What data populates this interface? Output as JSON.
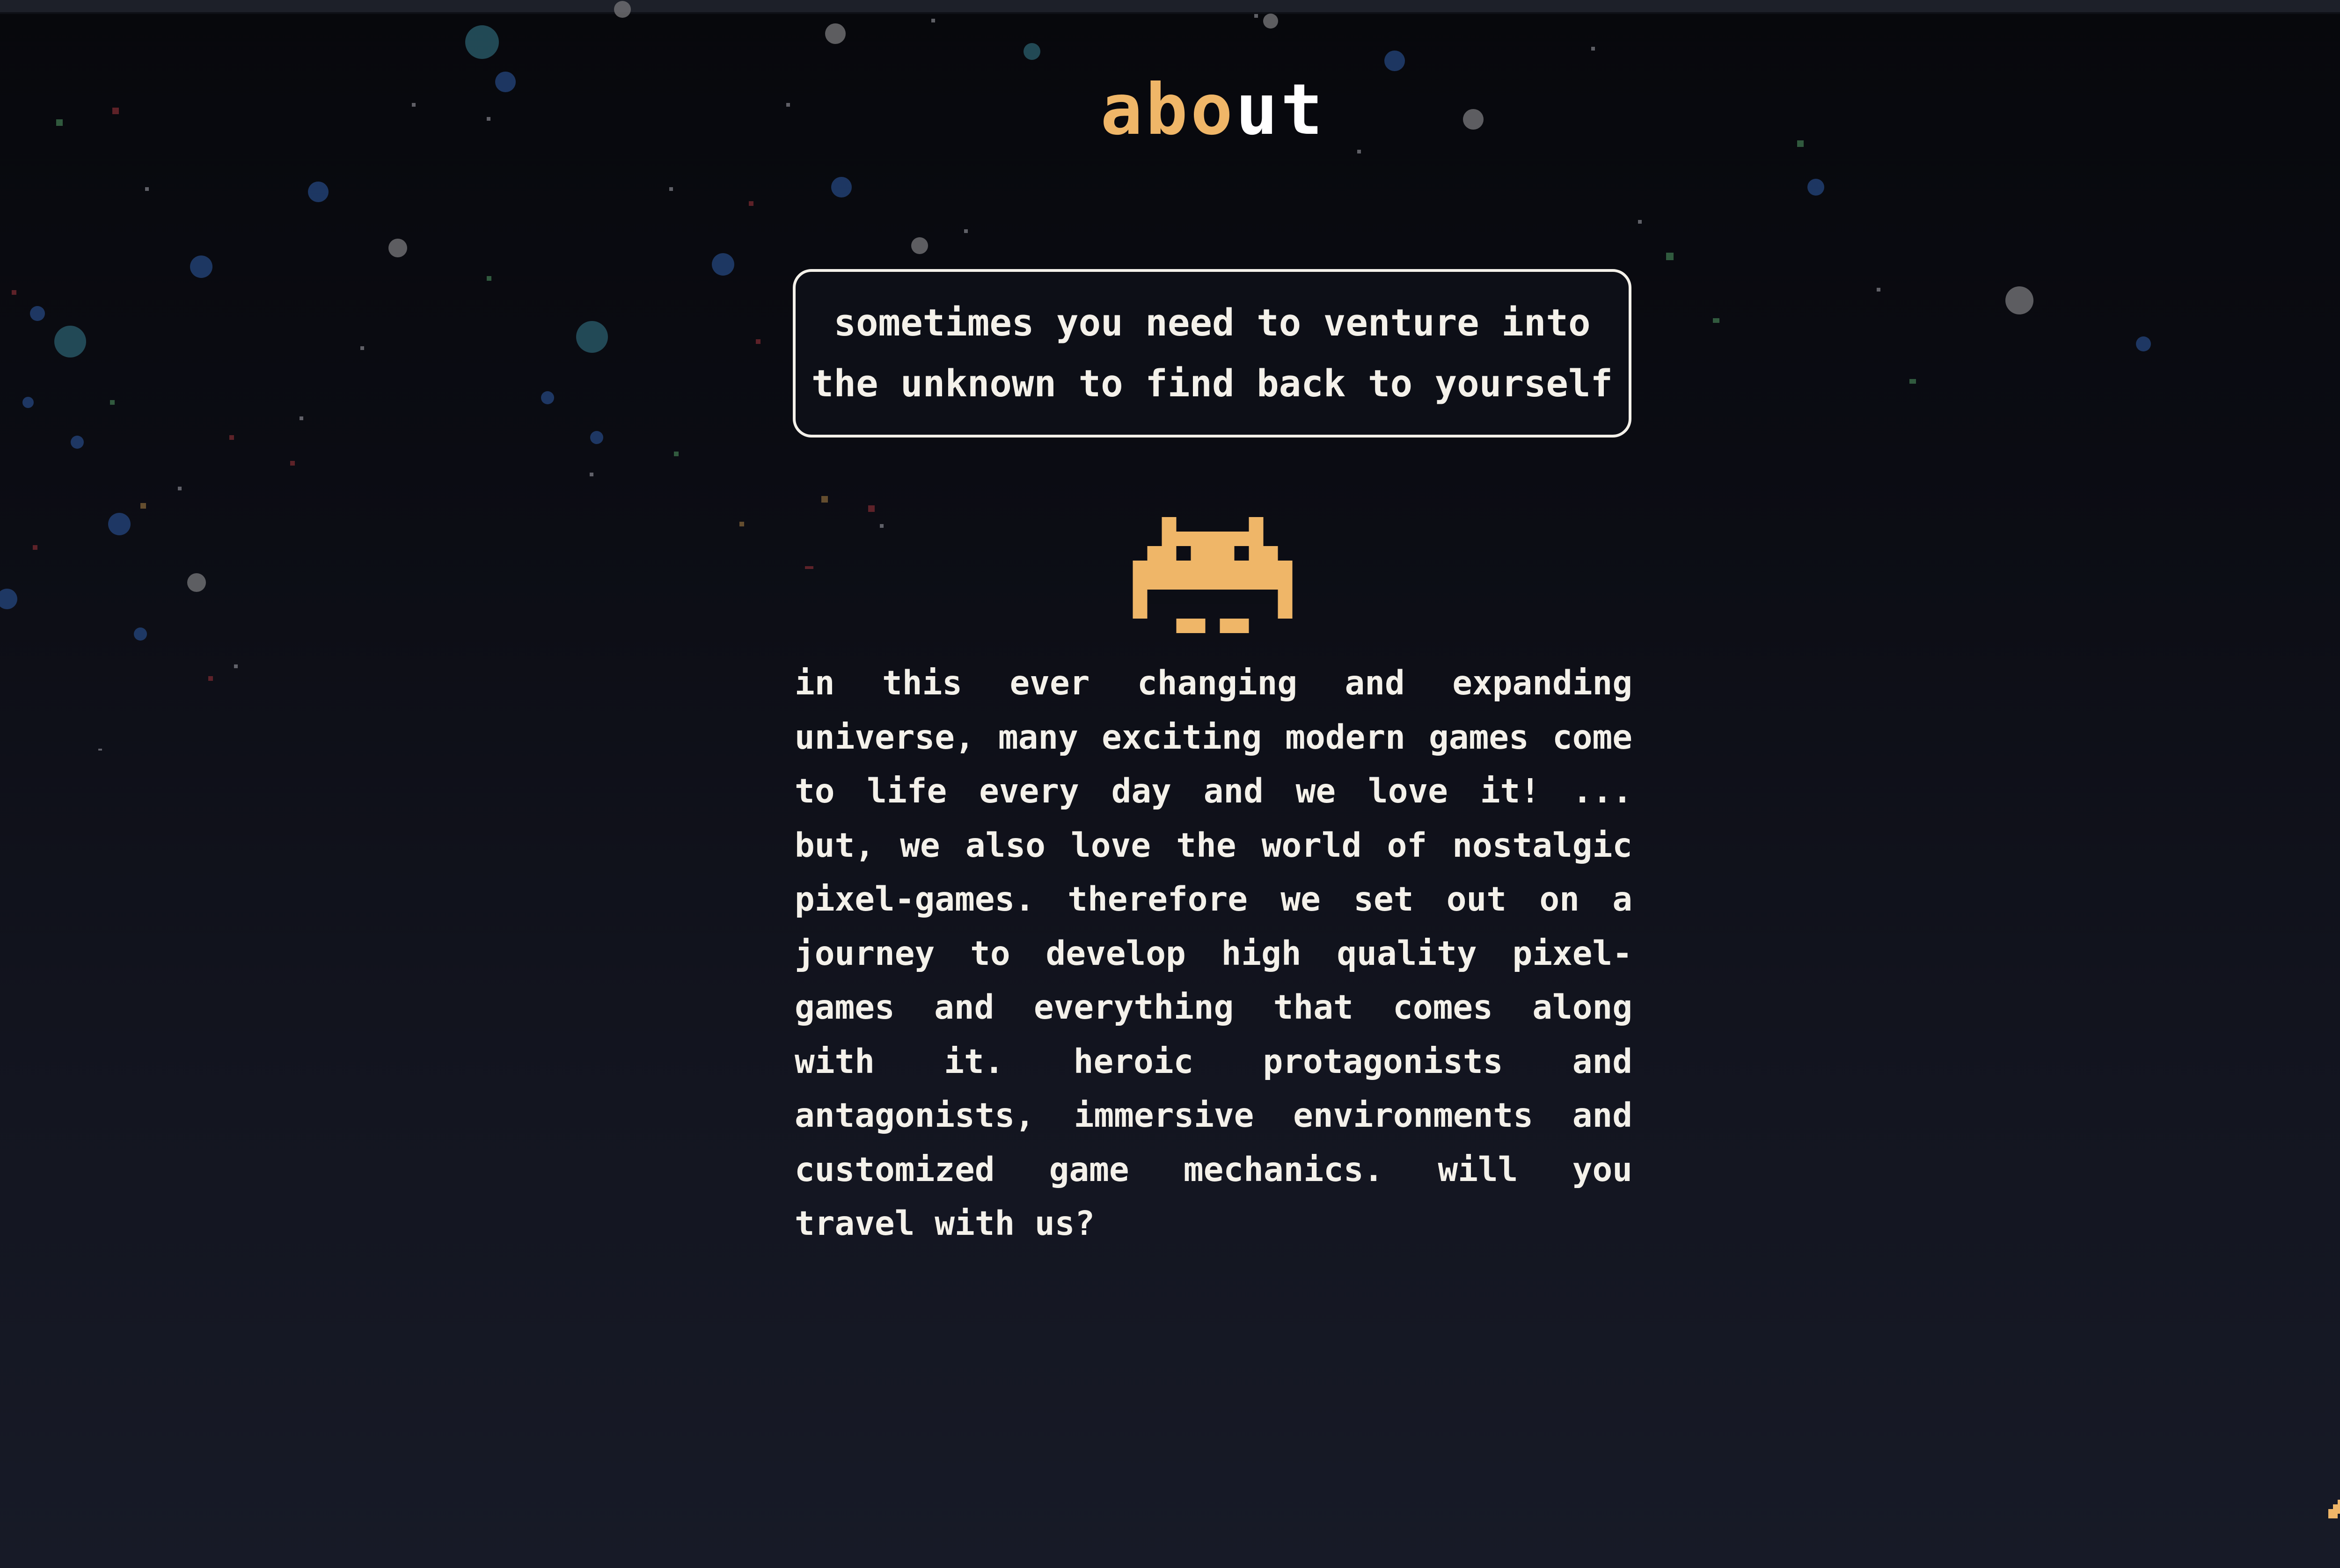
{
  "section": {
    "title_accent": "abo",
    "title_rest": "ut"
  },
  "quote": {
    "line1": "sometimes you need to venture into",
    "line2": "the unknown to find back to yourself"
  },
  "mascot_icon": "space-invader-icon",
  "body": {
    "paragraph": "in this ever changing and expanding universe, many exciting modern games come to life every day and we love it! ... but, we also love the world of nostalgic pixel-games. therefore we set out on a journey to develop high quality pixel-games and everything that comes along with it. heroic protagonists and antagonists, immersive environments and customized game mechanics. will you travel with us?"
  },
  "controls": {
    "back_to_top_icon": "chevron-up-icon"
  },
  "colors": {
    "accent": "#efb668",
    "text": "#f4f1ea",
    "background_top": "#07080c",
    "background_bottom": "#171a27"
  }
}
